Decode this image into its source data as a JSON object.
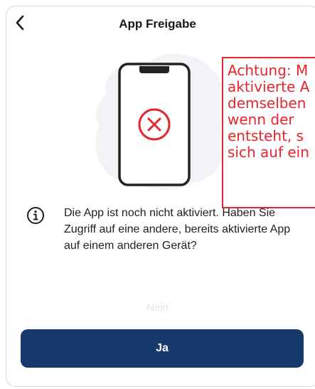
{
  "header": {
    "title": "App Freigabe",
    "back_icon": "chevron-left-icon"
  },
  "illustration": {
    "phone_icon": "smartphone-icon",
    "status_icon": "error-x-icon",
    "accent_color": "#e8252c"
  },
  "warning": {
    "text": "Achtung: M\naktivierte A\ndemselben\nwenn der\nentsteht, s\nsich auf ein"
  },
  "info": {
    "icon": "info-icon",
    "text": "Die App ist noch nicht aktiviert. Haben Sie Zugriff auf eine andere, bereits aktivierte App auf einem anderen Gerät?"
  },
  "actions": {
    "secondary_label": "Nein",
    "primary_label": "Ja",
    "primary_color": "#163a6b"
  }
}
